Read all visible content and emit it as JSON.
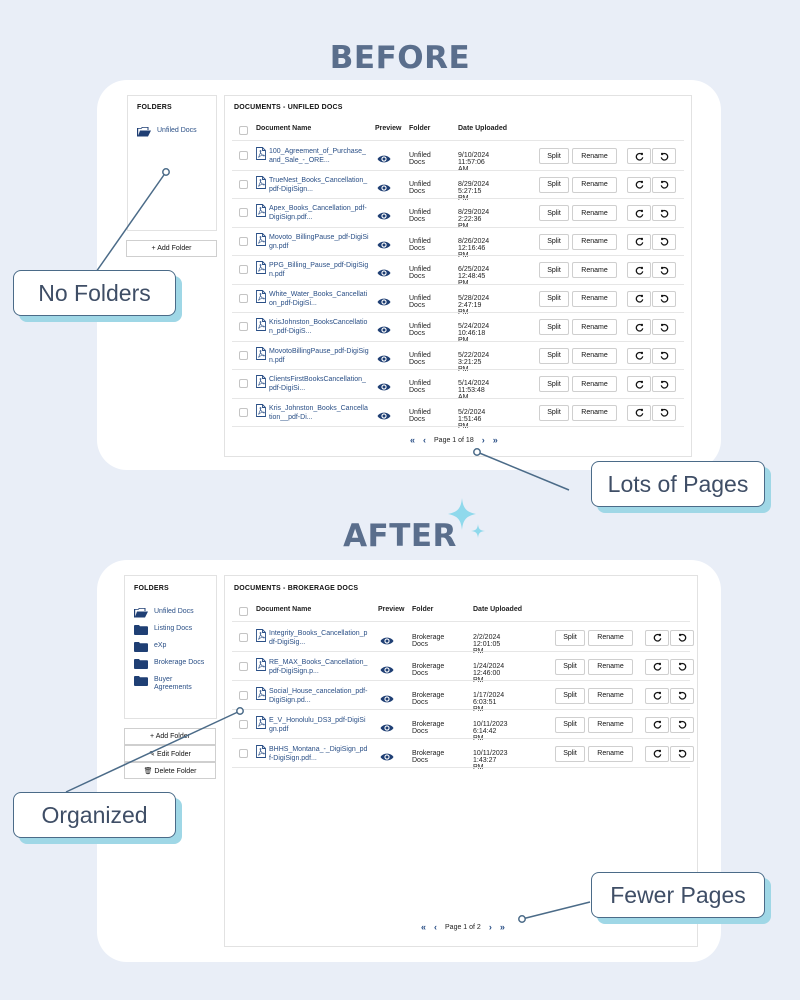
{
  "headings": {
    "before": "BEFORE",
    "after": "AFTER"
  },
  "callouts": {
    "no_folders": "No Folders",
    "lots_of_pages": "Lots of Pages",
    "organized": "Organized",
    "fewer_pages": "Fewer Pages"
  },
  "before": {
    "folders_title": "FOLDERS",
    "folders": [
      {
        "label": "Unfiled Docs",
        "icon": "folder-open-icon"
      }
    ],
    "buttons": {
      "add_folder": "+ Add Folder"
    },
    "docs_title": "DOCUMENTS - UNFILED DOCS",
    "columns": {
      "name": "Document Name",
      "preview": "Preview",
      "folder": "Folder",
      "date": "Date Uploaded"
    },
    "rows": [
      {
        "name": "100_Agreement_of_Purchase_and_Sale_-_ORE...",
        "folder": "Unfiled Docs",
        "date": "9/10/2024 11:57:06 AM"
      },
      {
        "name": "TrueNest_Books_Cancellation_pdf-DigiSign...",
        "folder": "Unfiled Docs",
        "date": "8/29/2024 5:27:15 PM"
      },
      {
        "name": "Apex_Books_Cancellation_pdf-DigiSign.pdf...",
        "folder": "Unfiled Docs",
        "date": "8/29/2024 2:22:36 PM"
      },
      {
        "name": "Movoto_BillingPause_pdf-DigiSign.pdf",
        "folder": "Unfiled Docs",
        "date": "8/26/2024 12:16:46 PM"
      },
      {
        "name": "PPG_Billing_Pause_pdf-DigiSign.pdf",
        "folder": "Unfiled Docs",
        "date": "6/25/2024 12:48:45 PM"
      },
      {
        "name": "White_Water_Books_Cancellation_pdf-DigiSi...",
        "folder": "Unfiled Docs",
        "date": "5/28/2024 2:47:19 PM"
      },
      {
        "name": "KrisJohnston_BooksCancellation_pdf-DigiS...",
        "folder": "Unfiled Docs",
        "date": "5/24/2024 10:46:18 PM"
      },
      {
        "name": "MovotoBillingPause_pdf-DigiSign.pdf",
        "folder": "Unfiled Docs",
        "date": "5/22/2024 3:21:25 PM"
      },
      {
        "name": "ClientsFirstBooksCancellation_pdf-DigiSi...",
        "folder": "Unfiled Docs",
        "date": "5/14/2024 11:53:48 AM"
      },
      {
        "name": "Kris_Johnston_Books_Cancellation__pdf-Di...",
        "folder": "Unfiled Docs",
        "date": "5/2/2024 1:51:46 PM"
      }
    ],
    "row_buttons": {
      "split": "Split",
      "rename": "Rename"
    },
    "pager": {
      "text": "Page 1 of 18",
      "first": "«",
      "prev": "‹",
      "next": "›",
      "last": "»"
    }
  },
  "after": {
    "folders_title": "FOLDERS",
    "folders": [
      {
        "label": "Unfiled Docs",
        "icon": "folder-open-icon"
      },
      {
        "label": "Listing Docs",
        "icon": "folder-icon"
      },
      {
        "label": "eXp",
        "icon": "folder-icon"
      },
      {
        "label": "Brokerage Docs",
        "icon": "folder-icon"
      },
      {
        "label": "Buyer Agreements",
        "icon": "folder-icon"
      }
    ],
    "buttons": {
      "add_folder": "+ Add Folder",
      "edit_folder": "✎ Edit Folder",
      "delete_folder": "🗑 Delete Folder"
    },
    "docs_title": "DOCUMENTS - BROKERAGE DOCS",
    "columns": {
      "name": "Document Name",
      "preview": "Preview",
      "folder": "Folder",
      "date": "Date Uploaded"
    },
    "rows": [
      {
        "name": "Integrity_Books_Cancellation_pdf-DigiSig...",
        "folder": "Brokerage Docs",
        "date": "2/2/2024 12:01:05 PM"
      },
      {
        "name": "RE_MAX_Books_Cancellation_pdf-DigiSign.p...",
        "folder": "Brokerage Docs",
        "date": "1/24/2024 12:46:00 PM"
      },
      {
        "name": "Social_House_cancelation_pdf-DigiSign.pd...",
        "folder": "Brokerage Docs",
        "date": "1/17/2024 6:03:51 PM"
      },
      {
        "name": "E_V_Honolulu_DS3_pdf-DigiSign.pdf",
        "folder": "Brokerage Docs",
        "date": "10/11/2023 6:14:42 PM"
      },
      {
        "name": "BHHS_Montana_-_DigiSign_pdf-DigiSign.pdf...",
        "folder": "Brokerage Docs",
        "date": "10/11/2023 1:43:27 PM"
      }
    ],
    "row_buttons": {
      "split": "Split",
      "rename": "Rename"
    },
    "pager": {
      "text": "Page 1 of 2",
      "first": "«",
      "prev": "‹",
      "next": "›",
      "last": "»"
    }
  },
  "colors": {
    "accent": "#2a4f86",
    "callout_shadow": "#9fd7e6",
    "heading": "#5a6e8c",
    "sparkle": "#8fd9ec"
  }
}
